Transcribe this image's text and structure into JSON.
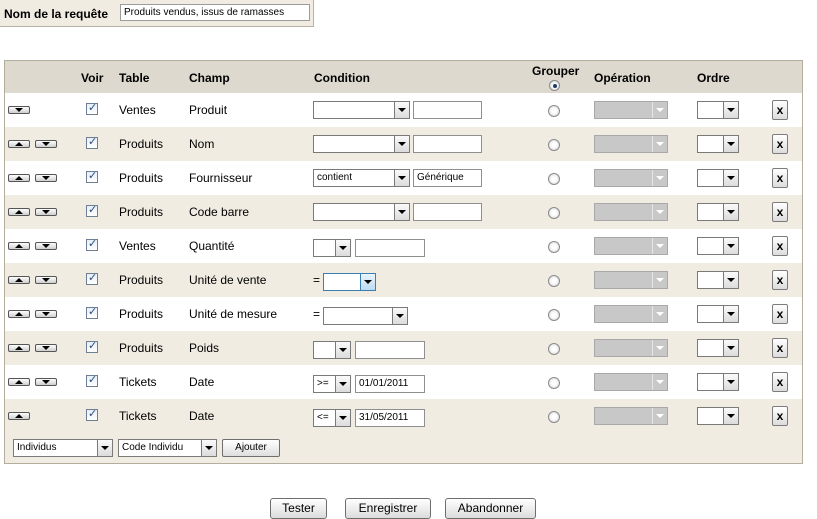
{
  "request": {
    "label": "Nom de la requête",
    "value": "Produits vendus, issus de ramasses"
  },
  "headers": {
    "voir": "Voir",
    "table": "Table",
    "champ": "Champ",
    "condition": "Condition",
    "grouper": "Grouper",
    "operation": "Opération",
    "ordre": "Ordre"
  },
  "rows": [
    {
      "arrows": "down",
      "table": "Ventes",
      "champ": "Produit",
      "cond_type": "wide",
      "cond_value": "",
      "text": ""
    },
    {
      "arrows": "both",
      "table": "Produits",
      "champ": "Nom",
      "cond_type": "wide",
      "cond_value": "",
      "text": ""
    },
    {
      "arrows": "both",
      "table": "Produits",
      "champ": "Fournisseur",
      "cond_type": "wide",
      "cond_value": "contient",
      "text": "Générique"
    },
    {
      "arrows": "both",
      "table": "Produits",
      "champ": "Code barre",
      "cond_type": "wide",
      "cond_value": "",
      "text": ""
    },
    {
      "arrows": "both",
      "table": "Ventes",
      "champ": "Quantité",
      "cond_type": "small",
      "cond_value": "",
      "text": ""
    },
    {
      "arrows": "both",
      "table": "Produits",
      "champ": "Unité de vente",
      "cond_type": "eq",
      "eq": "=",
      "text": ""
    },
    {
      "arrows": "both",
      "table": "Produits",
      "champ": "Unité de mesure",
      "cond_type": "eq2",
      "eq": "=",
      "text": ""
    },
    {
      "arrows": "both",
      "table": "Produits",
      "champ": "Poids",
      "cond_type": "small",
      "cond_value": "",
      "text": ""
    },
    {
      "arrows": "both",
      "table": "Tickets",
      "champ": "Date",
      "cond_type": "small",
      "cond_value": ">=",
      "text": "01/01/2011"
    },
    {
      "arrows": "up",
      "table": "Tickets",
      "champ": "Date",
      "cond_type": "small",
      "cond_value": "<=",
      "text": "31/05/2011"
    }
  ],
  "row_action": "x",
  "footer": {
    "select1": "Individus",
    "select2": "Code Individu",
    "add_label": "Ajouter"
  },
  "actions": {
    "test": "Tester",
    "save": "Enregistrer",
    "cancel": "Abandonner"
  },
  "colors": {
    "header_bg": "#ddd9ce",
    "alt_row_bg": "#f0ece2",
    "disabled_select": "#c8c8c8"
  }
}
